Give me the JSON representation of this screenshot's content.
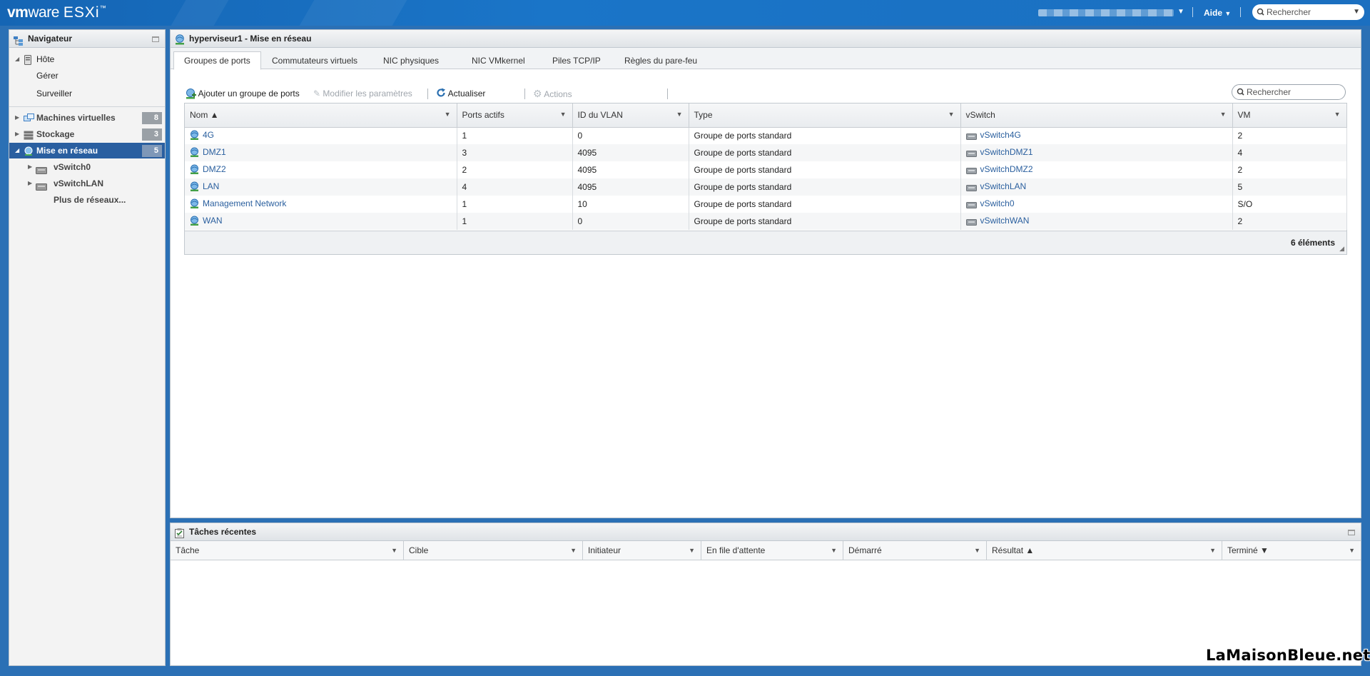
{
  "brand": {
    "vm": "vm",
    "ware": "ware",
    "product": "ESXi",
    "tm": "™"
  },
  "topbar": {
    "help_label": "Aide",
    "search_placeholder": "Rechercher"
  },
  "navigator": {
    "title": "Navigateur",
    "host": "Hôte",
    "manage": "Gérer",
    "monitor": "Surveiller",
    "vms": {
      "label": "Machines virtuelles",
      "count": "8"
    },
    "storage": {
      "label": "Stockage",
      "count": "3"
    },
    "network": {
      "label": "Mise en réseau",
      "count": "5"
    },
    "vswitch0": "vSwitch0",
    "vswitchlan": "vSwitchLAN",
    "more_networks": "Plus de réseaux..."
  },
  "main": {
    "title": "hyperviseur1 - Mise en réseau",
    "tabs": [
      "Groupes de ports",
      "Commutateurs virtuels",
      "NIC physiques",
      "NIC VMkernel",
      "Piles TCP/IP",
      "Règles du pare-feu"
    ],
    "toolbar": {
      "add": "Ajouter un groupe de ports",
      "edit": "Modifier les paramètres",
      "refresh": "Actualiser",
      "actions": "Actions"
    },
    "search_placeholder": "Rechercher",
    "columns": [
      "Nom ▲",
      "Ports actifs",
      "ID du VLAN",
      "Type",
      "vSwitch",
      "VM"
    ],
    "rows": [
      {
        "name": "4G",
        "ports": "1",
        "vlan": "0",
        "type": "Groupe de ports standard",
        "vswitch": "vSwitch4G",
        "vm": "2"
      },
      {
        "name": "DMZ1",
        "ports": "3",
        "vlan": "4095",
        "type": "Groupe de ports standard",
        "vswitch": "vSwitchDMZ1",
        "vm": "4"
      },
      {
        "name": "DMZ2",
        "ports": "2",
        "vlan": "4095",
        "type": "Groupe de ports standard",
        "vswitch": "vSwitchDMZ2",
        "vm": "2"
      },
      {
        "name": "LAN",
        "ports": "4",
        "vlan": "4095",
        "type": "Groupe de ports standard",
        "vswitch": "vSwitchLAN",
        "vm": "5"
      },
      {
        "name": "Management Network",
        "ports": "1",
        "vlan": "10",
        "type": "Groupe de ports standard",
        "vswitch": "vSwitch0",
        "vm": "S/O"
      },
      {
        "name": "WAN",
        "ports": "1",
        "vlan": "0",
        "type": "Groupe de ports standard",
        "vswitch": "vSwitchWAN",
        "vm": "2"
      }
    ],
    "item_count": "6 éléments"
  },
  "tasks": {
    "title": "Tâches récentes",
    "columns": [
      "Tâche",
      "Cible",
      "Initiateur",
      "En file d'attente",
      "Démarré",
      "Résultat ▲",
      "Terminé ▼"
    ]
  },
  "watermark": "LaMaisonBleue.net",
  "colors": {
    "topbar": "#1a75c8",
    "accent": "#2a5fa0",
    "link": "#2a5f9e",
    "badge": "#9aa0a6"
  }
}
